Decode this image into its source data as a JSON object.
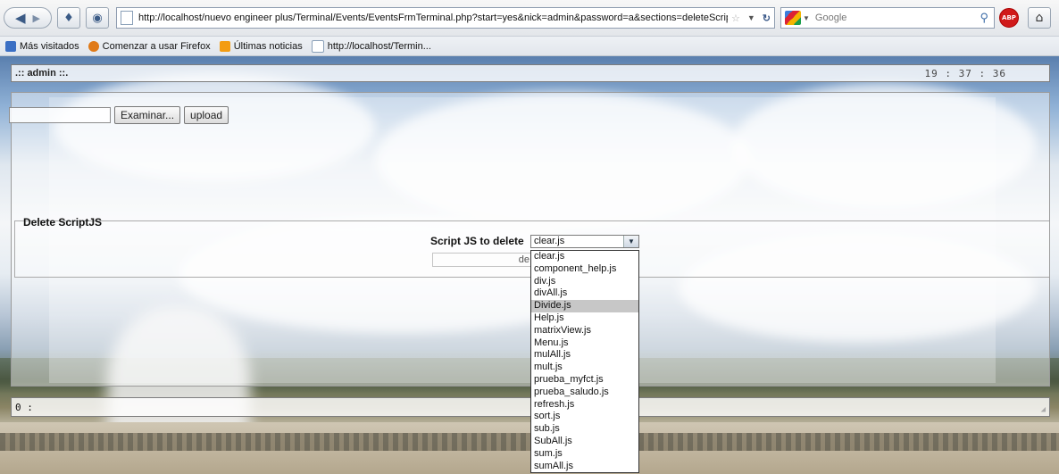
{
  "browser": {
    "url": "http://localhost/nuevo engineer plus/Terminal/Events/EventsFrmTerminal.php?start=yes&nick=admin&password=a&sections=deleteScriptJS_unRegiste",
    "search_placeholder": "Google",
    "abp_label": "ABP",
    "back_icon": "back-arrow-icon",
    "forward_icon": "forward-arrow-icon"
  },
  "bookmarks": [
    {
      "label": "Más visitados",
      "icon": "most-visited-icon",
      "color": "#3b6fc4"
    },
    {
      "label": "Comenzar a usar Firefox",
      "icon": "firefox-icon",
      "color": "#e07a18"
    },
    {
      "label": "Últimas noticias",
      "icon": "rss-icon",
      "color": "#f39c12"
    },
    {
      "label": "http://localhost/Termin...",
      "icon": "page-icon",
      "color": "#ffffff"
    }
  ],
  "header": {
    "user": ".:: admin ::.",
    "clock": "19 : 37 : 36"
  },
  "upload": {
    "browse_label": "Examinar...",
    "upload_label": "upload"
  },
  "delete_section": {
    "title": "Delete ScriptJS",
    "label": "Script JS to delete",
    "selected": "clear.js",
    "button_partial": "de",
    "options": [
      "clear.js",
      "component_help.js",
      "div.js",
      "divAll.js",
      "Divide.js",
      "Help.js",
      "matrixView.js",
      "Menu.js",
      "mulAll.js",
      "mult.js",
      "prueba_myfct.js",
      "prueba_saludo.js",
      "refresh.js",
      "sort.js",
      "sub.js",
      "SubAll.js",
      "sum.js",
      "sumAll.js"
    ],
    "highlighted": "Divide.js"
  },
  "status": {
    "text": "0 :"
  }
}
